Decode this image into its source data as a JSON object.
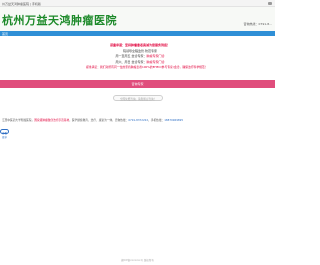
{
  "topbar": {
    "text": "州万益天鸿肿瘤医院 | 手机版"
  },
  "header": {
    "logo": "杭州万益天鸿肿瘤医院",
    "right_text": "咨询热线：0791-8..."
  },
  "navbar": {
    "item": "首页"
  },
  "notice": {
    "line1": "郑重承诺：坚持肿瘤患者真诚为您服务到底！",
    "line2": "院领导全程监管·防范专家",
    "line3_prefix": "周一至周五 坐诊专家：",
    "line3_link": "肿瘤专家门诊",
    "line4_prefix": "周六、周日 坐诊专家：",
    "line4_link": "肿瘤专家门诊",
    "line5": "郑重承诺：我们对所有同一位的坚持肿瘤患者100%的EHEO(参与专家)会诊，确保治疗科学规范！"
  },
  "pink_bar": {
    "label": "咨询专家"
  },
  "search": {
    "placeholder": "全国免费咨询，请您留言咨询！"
  },
  "intro": {
    "prefix": "江西中医药大学附属医院，",
    "red": "国家级肿瘤微创治疗示范基地",
    "mid": "，医学继续教育，治疗、康复为一体，咨询热线：",
    "phone1": "0791-8372222",
    "sep": "，手机热线：",
    "phone2": "18879969895"
  },
  "more_button": {
    "label": "查看更多"
  },
  "footer": {
    "text": "赣ICP备xxxxxxx号 版权所有"
  },
  "colors": {
    "brand_green": "#1d8a2a",
    "nav_blue": "#2f8fd6",
    "accent_pink": "#e04d7c",
    "alert_red": "#e0003a"
  }
}
